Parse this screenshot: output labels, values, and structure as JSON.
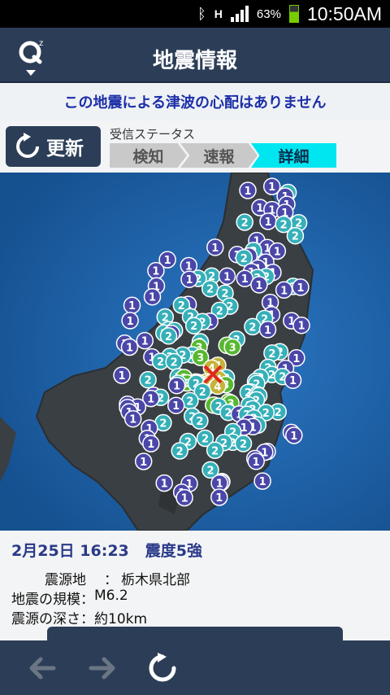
{
  "status_bar": {
    "battery": "63%",
    "time": "10:50AM",
    "network": "H"
  },
  "header": {
    "title": "地震情報"
  },
  "banner": {
    "tsunami": "この地震による津波の心配はありません"
  },
  "controls": {
    "refresh_label": "更新",
    "status_caption": "受信ステータス",
    "steps": [
      "検知",
      "速報",
      "詳細"
    ],
    "active_step": "詳細"
  },
  "map": {
    "epicenter_label": "×",
    "intensity_colors": {
      "1": "#4a47a8",
      "2": "#36b0b8",
      "3": "#57b830",
      "4": "#c4b43a"
    }
  },
  "info": {
    "datetime": "2月25日 16:23",
    "max_intensity": "震度5強",
    "rows": [
      {
        "key": "震源地",
        "value": "栃木県北部"
      },
      {
        "key": "地震の規模",
        "value": "M6.2"
      },
      {
        "key": "震源の深さ",
        "value": "約10km"
      }
    ]
  },
  "nav": {
    "back_icon": "arrow-left-icon",
    "forward_icon": "arrow-right-icon",
    "reload_icon": "reload-icon"
  }
}
